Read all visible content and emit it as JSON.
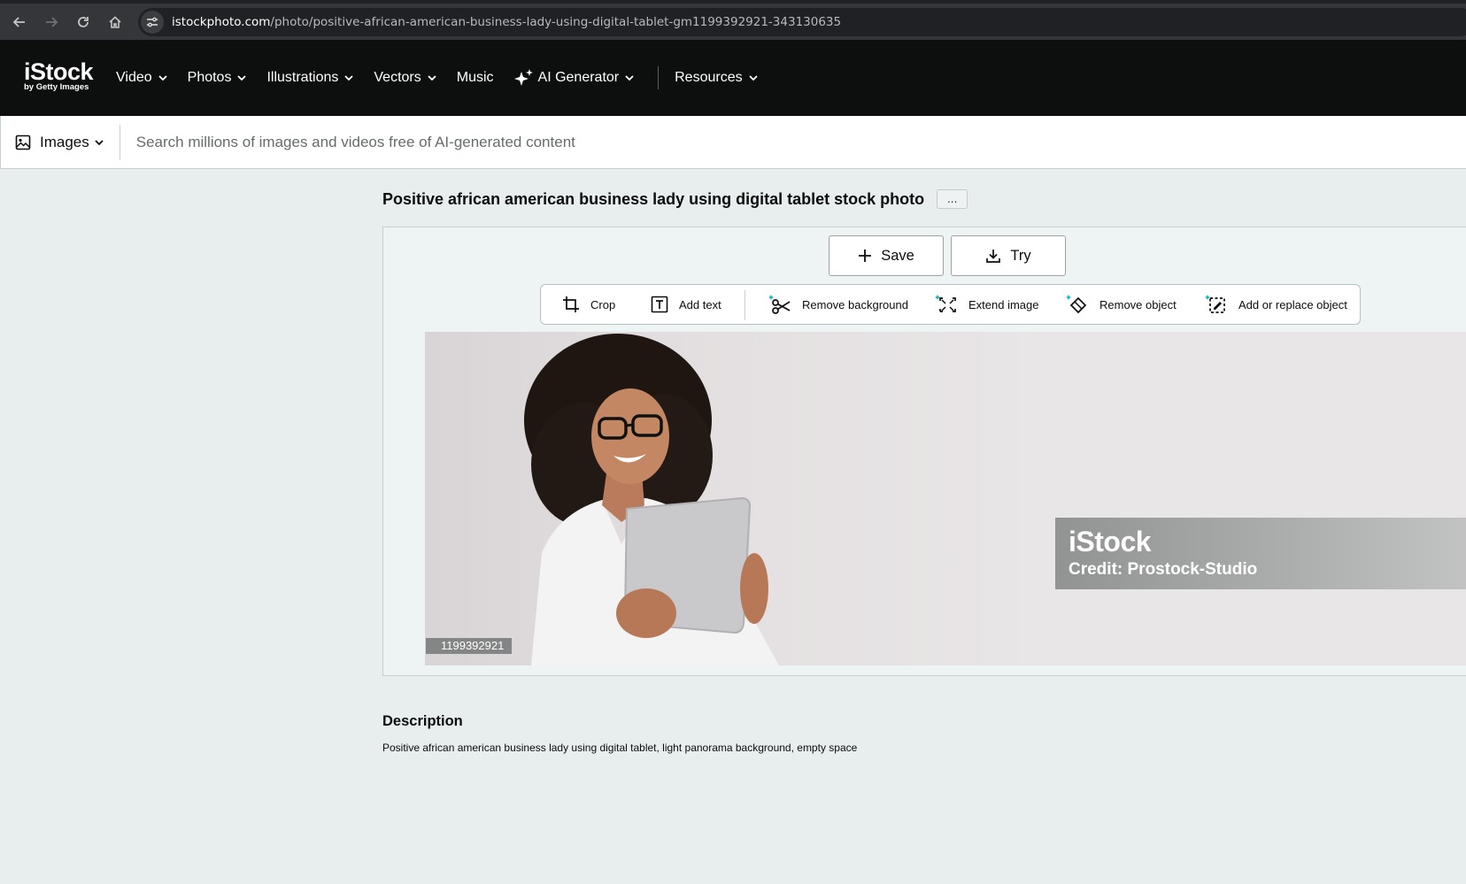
{
  "browser": {
    "url_host": "istockphoto.com",
    "url_path": "/photo/positive-african-american-business-lady-using-digital-tablet-gm1199392921-343130635"
  },
  "header": {
    "logo_main": "iStock",
    "logo_sub": "by Getty Images",
    "nav": [
      {
        "label": "Video",
        "has_chevron": true
      },
      {
        "label": "Photos",
        "has_chevron": true
      },
      {
        "label": "Illustrations",
        "has_chevron": true
      },
      {
        "label": "Vectors",
        "has_chevron": true
      },
      {
        "label": "Music",
        "has_chevron": false
      },
      {
        "label": "AI Generator",
        "has_chevron": true,
        "icon": "sparkle-icon"
      },
      {
        "label": "Resources",
        "has_chevron": true
      }
    ]
  },
  "search": {
    "media_type": "Images",
    "placeholder": "Search millions of images and videos free of AI-generated content"
  },
  "photo_page": {
    "title": "Positive african american business lady using digital tablet stock photo",
    "more_label": "...",
    "save_label": "Save",
    "try_label": "Try",
    "tools": [
      {
        "label": "Crop",
        "icon": "crop-icon"
      },
      {
        "label": "Add text",
        "icon": "text-icon"
      },
      {
        "label": "Remove background",
        "icon": "scissors-icon"
      },
      {
        "label": "Extend image",
        "icon": "extend-icon"
      },
      {
        "label": "Remove object",
        "icon": "eraser-icon"
      },
      {
        "label": "Add or replace object",
        "icon": "replace-object-icon"
      }
    ],
    "image_id": "1199392921",
    "watermark_logo": "iStock",
    "watermark_credit": "Credit: Prostock-Studio",
    "description_heading": "Description",
    "description": "Positive african american business lady using digital tablet, light panorama background, empty space"
  },
  "colors": {
    "header_bg": "#0d0e0e",
    "page_bg": "#e8eeee",
    "ai_accent": "#0fb5c4"
  }
}
